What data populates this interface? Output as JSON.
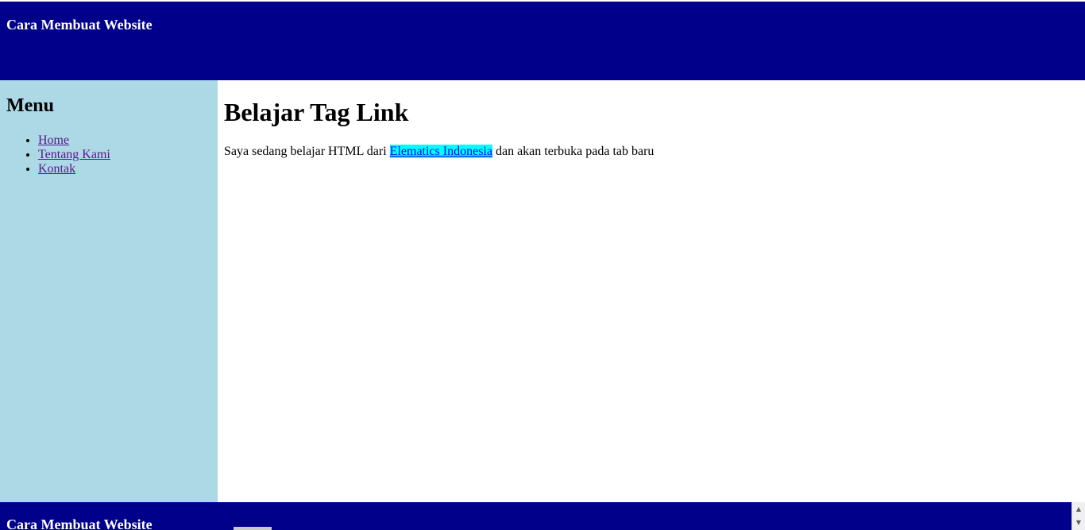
{
  "header": {
    "title": "Cara Membuat Website"
  },
  "sidebar": {
    "title": "Menu",
    "items": [
      {
        "label": "Home"
      },
      {
        "label": "Tentang Kami"
      },
      {
        "label": "Kontak"
      }
    ]
  },
  "main": {
    "title": "Belajar Tag Link",
    "text_before": "Saya sedang belajar HTML dari ",
    "link_text": "Elematics Indonesia",
    "text_after": " dan akan terbuka pada tab baru"
  },
  "footer": {
    "title": "Cara Membuat Website"
  },
  "colors": {
    "header_bg": "#00008b",
    "sidebar_bg": "#add8e6",
    "link_highlight": "#00ffff"
  },
  "icons": {
    "scroll_up": "scroll-up-arrow-icon",
    "scroll_down": "scroll-down-arrow-icon"
  }
}
